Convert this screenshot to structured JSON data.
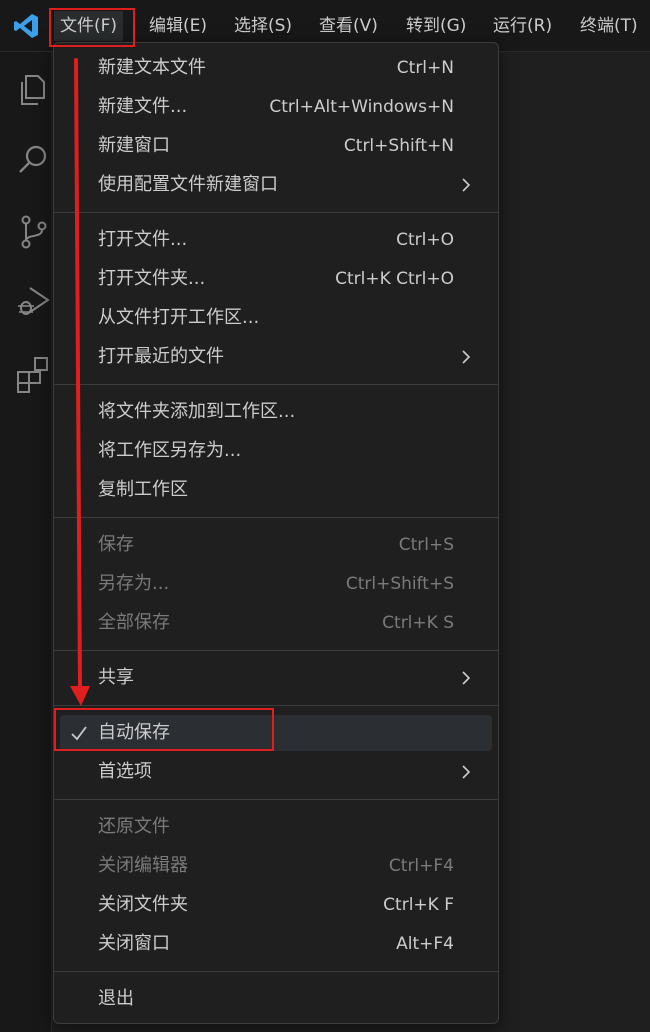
{
  "menubar": {
    "items": [
      {
        "label": "文件(F)"
      },
      {
        "label": "编辑(E)"
      },
      {
        "label": "选择(S)"
      },
      {
        "label": "查看(V)"
      },
      {
        "label": "转到(G)"
      },
      {
        "label": "运行(R)"
      },
      {
        "label": "终端(T)"
      }
    ]
  },
  "activity_bar": {
    "icons": [
      "explorer-icon",
      "search-icon",
      "source-control-icon",
      "run-debug-icon",
      "extensions-icon"
    ]
  },
  "file_menu": {
    "items": [
      {
        "label": "新建文本文件",
        "shortcut": "Ctrl+N"
      },
      {
        "label": "新建文件...",
        "shortcut": "Ctrl+Alt+Windows+N"
      },
      {
        "label": "新建窗口",
        "shortcut": "Ctrl+Shift+N"
      },
      {
        "label": "使用配置文件新建窗口",
        "shortcut": ""
      },
      {
        "label": "打开文件...",
        "shortcut": "Ctrl+O"
      },
      {
        "label": "打开文件夹...",
        "shortcut": "Ctrl+K Ctrl+O"
      },
      {
        "label": "从文件打开工作区...",
        "shortcut": ""
      },
      {
        "label": "打开最近的文件",
        "shortcut": ""
      },
      {
        "label": "将文件夹添加到工作区...",
        "shortcut": ""
      },
      {
        "label": "将工作区另存为...",
        "shortcut": ""
      },
      {
        "label": "复制工作区",
        "shortcut": ""
      },
      {
        "label": "保存",
        "shortcut": "Ctrl+S",
        "disabled": true
      },
      {
        "label": "另存为...",
        "shortcut": "Ctrl+Shift+S",
        "disabled": true
      },
      {
        "label": "全部保存",
        "shortcut": "Ctrl+K S",
        "disabled": true
      },
      {
        "label": "共享",
        "shortcut": ""
      },
      {
        "label": "自动保存",
        "shortcut": "",
        "checked": true
      },
      {
        "label": "首选项",
        "shortcut": ""
      },
      {
        "label": "还原文件",
        "shortcut": "",
        "disabled": true
      },
      {
        "label": "关闭编辑器",
        "shortcut": "Ctrl+F4",
        "disabled": true
      },
      {
        "label": "关闭文件夹",
        "shortcut": "Ctrl+K F"
      },
      {
        "label": "关闭窗口",
        "shortcut": "Alt+F4"
      },
      {
        "label": "退出",
        "shortcut": ""
      }
    ]
  },
  "colors": {
    "annotation": "#e01e1e",
    "menu_background": "#1f1f1f",
    "highlight": "#2b2e33",
    "logo": "#3aa0e8"
  }
}
